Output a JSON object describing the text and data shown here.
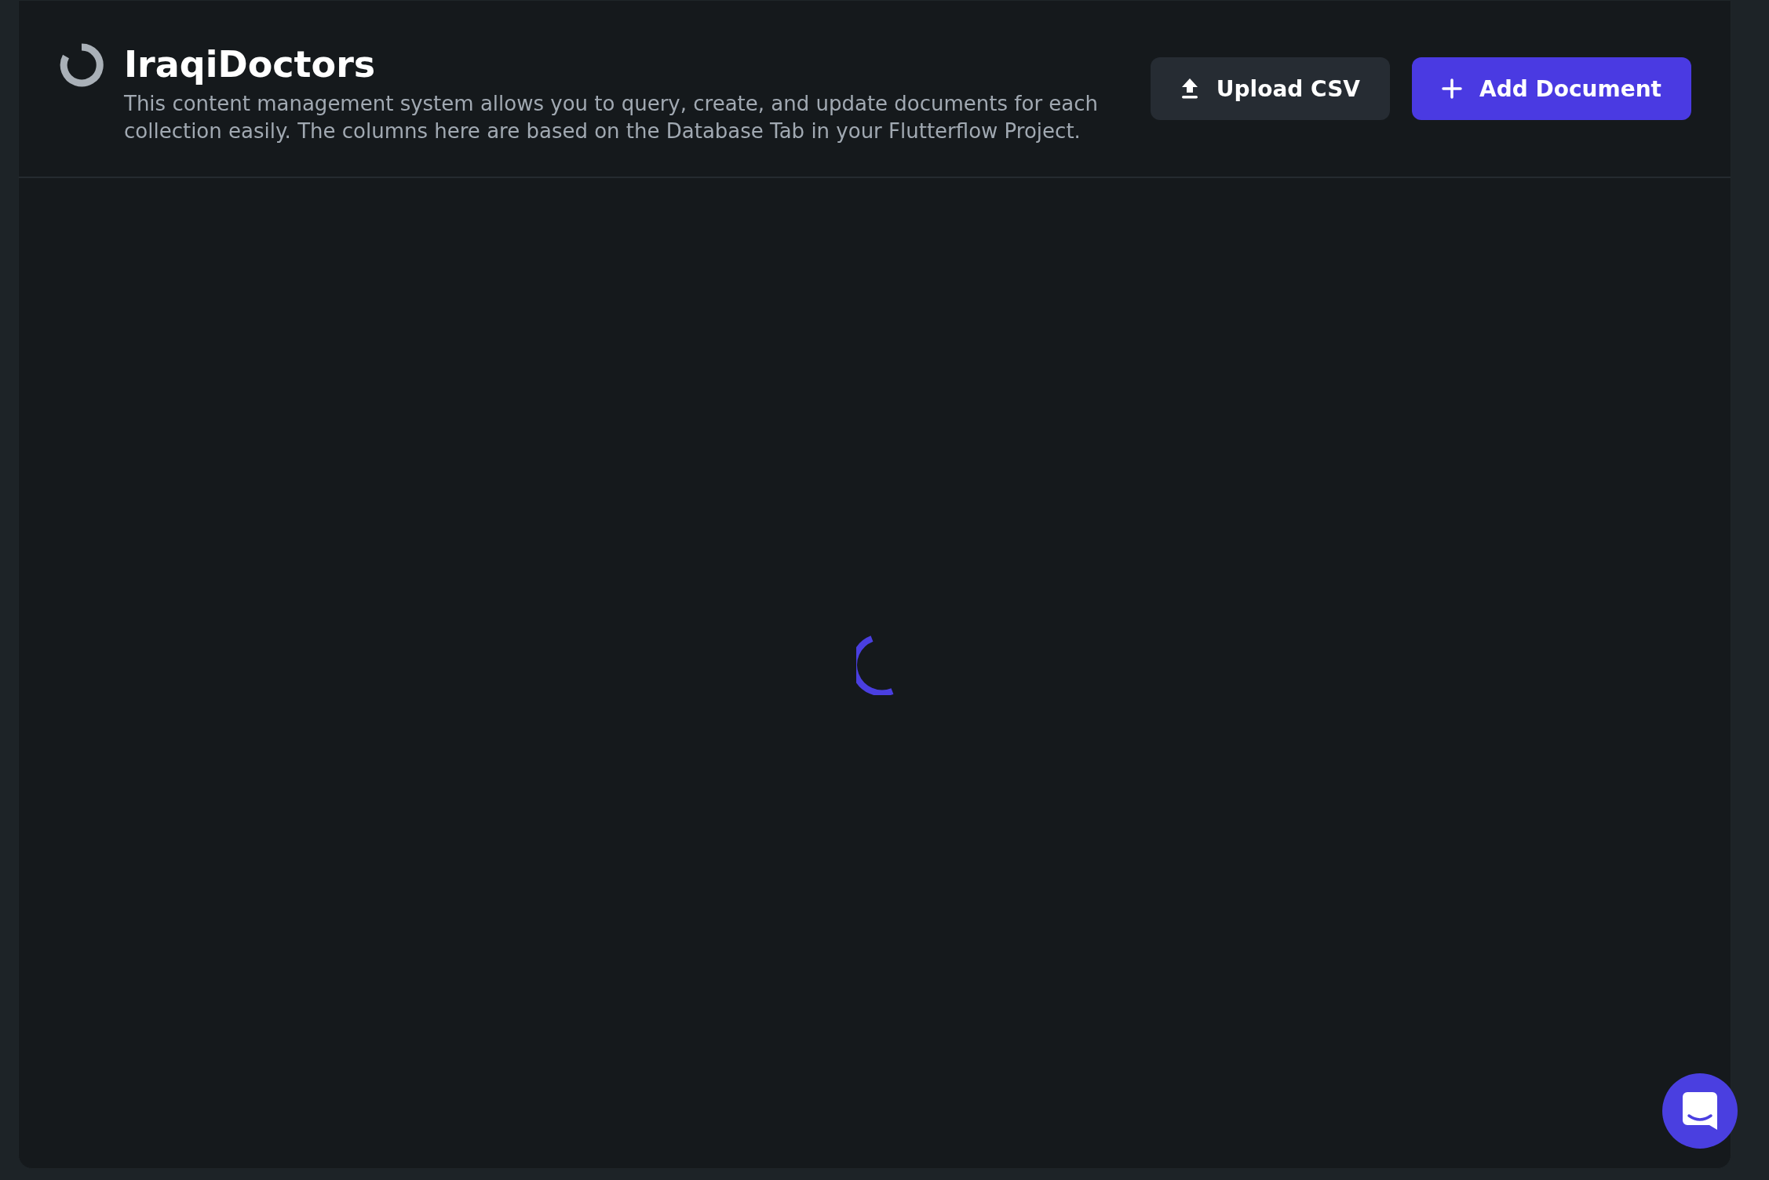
{
  "header": {
    "title": "IraqiDoctors",
    "description": "This content management system allows you to query, create, and update documents for each collection easily. The columns here are based on the Database Tab in your Flutterflow Project."
  },
  "buttons": [
    {
      "label": "Upload CSV",
      "kind": "secondary"
    },
    {
      "label": "Add Document",
      "kind": "primary"
    }
  ]
}
